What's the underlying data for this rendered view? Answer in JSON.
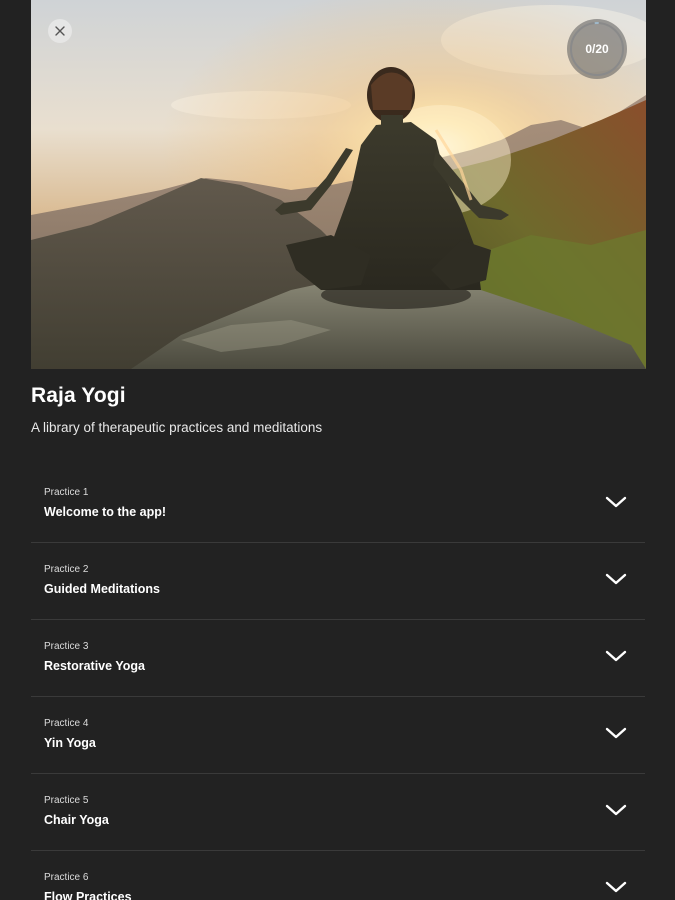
{
  "hero": {
    "close_icon": "close-icon",
    "progress": {
      "text": "0/20",
      "value": 0,
      "max": 20
    }
  },
  "header": {
    "title": "Raja Yogi",
    "subtitle": "A library of therapeutic practices and meditations"
  },
  "practices": [
    {
      "kicker": "Practice 1",
      "title": "Welcome to the app!"
    },
    {
      "kicker": "Practice 2",
      "title": "Guided Meditations"
    },
    {
      "kicker": "Practice 3",
      "title": "Restorative Yoga"
    },
    {
      "kicker": "Practice 4",
      "title": "Yin Yoga"
    },
    {
      "kicker": "Practice 5",
      "title": "Chair Yoga"
    },
    {
      "kicker": "Practice 6",
      "title": "Flow Practices"
    }
  ],
  "icons": {
    "expand": "chevron-down-icon"
  },
  "colors": {
    "background": "#222222",
    "divider": "#3a3a3a",
    "text": "#ffffff"
  }
}
